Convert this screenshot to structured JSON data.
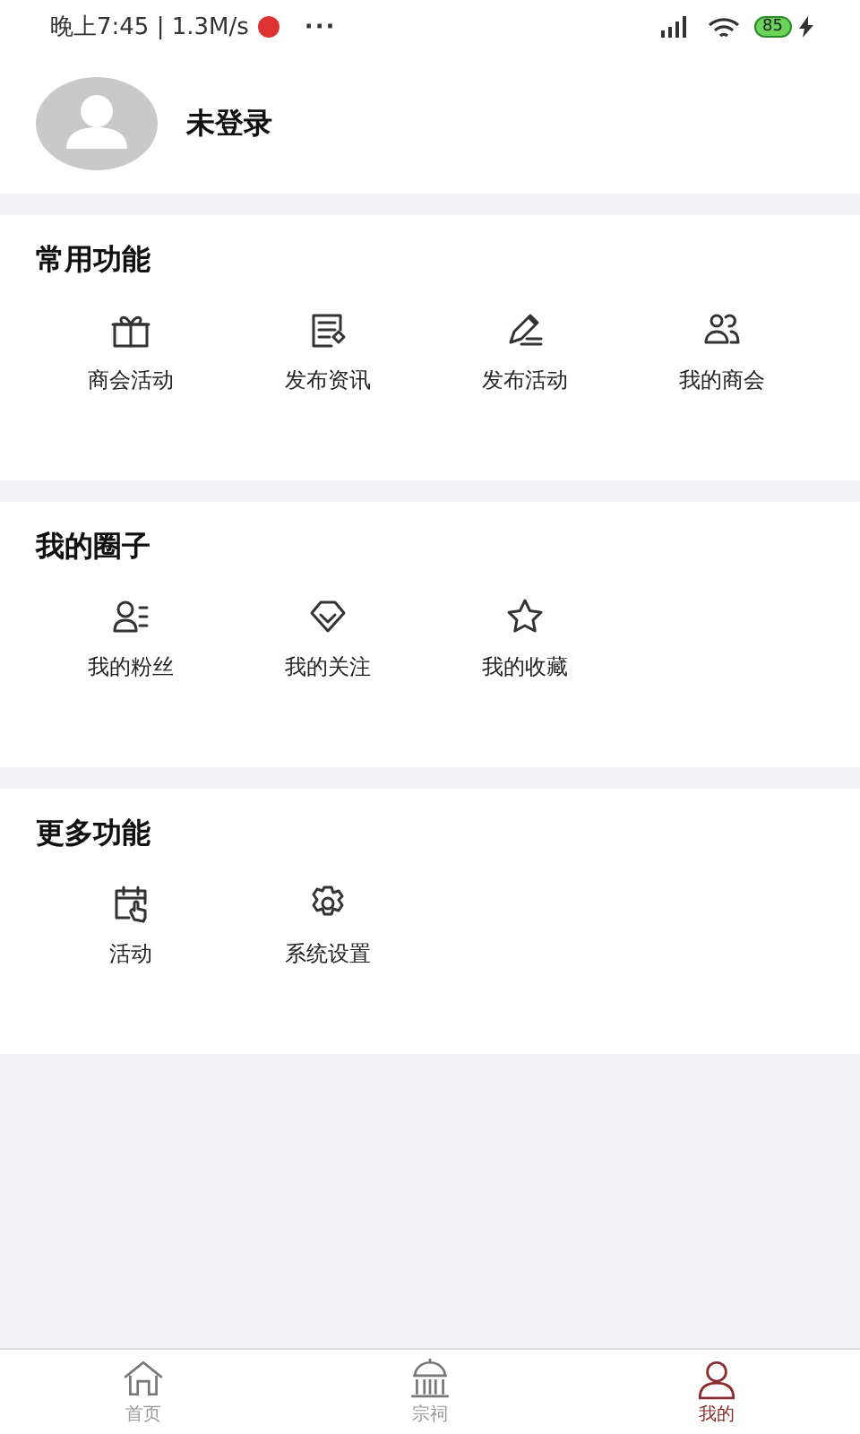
{
  "status_bar": {
    "time": "晚上7:45 | 1.3M/s",
    "more": "···",
    "battery": "85"
  },
  "profile": {
    "name": "未登录"
  },
  "sections": [
    {
      "title": "常用功能",
      "items": [
        {
          "label": "商会活动"
        },
        {
          "label": "发布资讯"
        },
        {
          "label": "发布活动"
        },
        {
          "label": "我的商会"
        }
      ]
    },
    {
      "title": "我的圈子",
      "items": [
        {
          "label": "我的粉丝"
        },
        {
          "label": "我的关注"
        },
        {
          "label": "我的收藏"
        }
      ]
    },
    {
      "title": "更多功能",
      "items": [
        {
          "label": "活动"
        },
        {
          "label": "系统设置"
        }
      ]
    }
  ],
  "tab_bar": [
    {
      "label": "首页",
      "selected": false
    },
    {
      "label": "宗祠",
      "selected": false
    },
    {
      "label": "我的",
      "selected": true
    }
  ]
}
